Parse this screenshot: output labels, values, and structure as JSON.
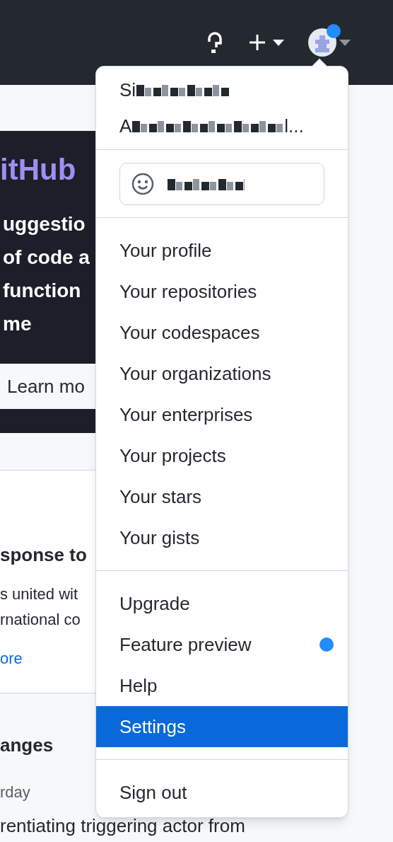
{
  "banner": {
    "title": "itHub",
    "lines": [
      "uggestio",
      "of code a",
      "function",
      "me"
    ],
    "button": "Learn mo"
  },
  "card": {
    "heading": "sponse to",
    "lines": [
      "s united wit",
      "rnational co"
    ],
    "link": "ore"
  },
  "changes": {
    "heading": "anges",
    "date": "rday",
    "line": "rentiating triggering actor from"
  },
  "header": {
    "avatar_dot": true
  },
  "menu": {
    "signed_in": [
      "Si",
      "A"
    ],
    "signed_in_end": "l...",
    "sections": [
      [
        {
          "label": "Your profile",
          "selected": false,
          "dot": false
        },
        {
          "label": "Your repositories",
          "selected": false,
          "dot": false
        },
        {
          "label": "Your codespaces",
          "selected": false,
          "dot": false
        },
        {
          "label": "Your organizations",
          "selected": false,
          "dot": false
        },
        {
          "label": "Your enterprises",
          "selected": false,
          "dot": false
        },
        {
          "label": "Your projects",
          "selected": false,
          "dot": false
        },
        {
          "label": "Your stars",
          "selected": false,
          "dot": false
        },
        {
          "label": "Your gists",
          "selected": false,
          "dot": false
        }
      ],
      [
        {
          "label": "Upgrade",
          "selected": false,
          "dot": false
        },
        {
          "label": "Feature preview",
          "selected": false,
          "dot": true
        },
        {
          "label": "Help",
          "selected": false,
          "dot": false
        },
        {
          "label": "Settings",
          "selected": true,
          "dot": false
        }
      ],
      [
        {
          "label": "Sign out",
          "selected": false,
          "dot": false
        }
      ]
    ]
  }
}
